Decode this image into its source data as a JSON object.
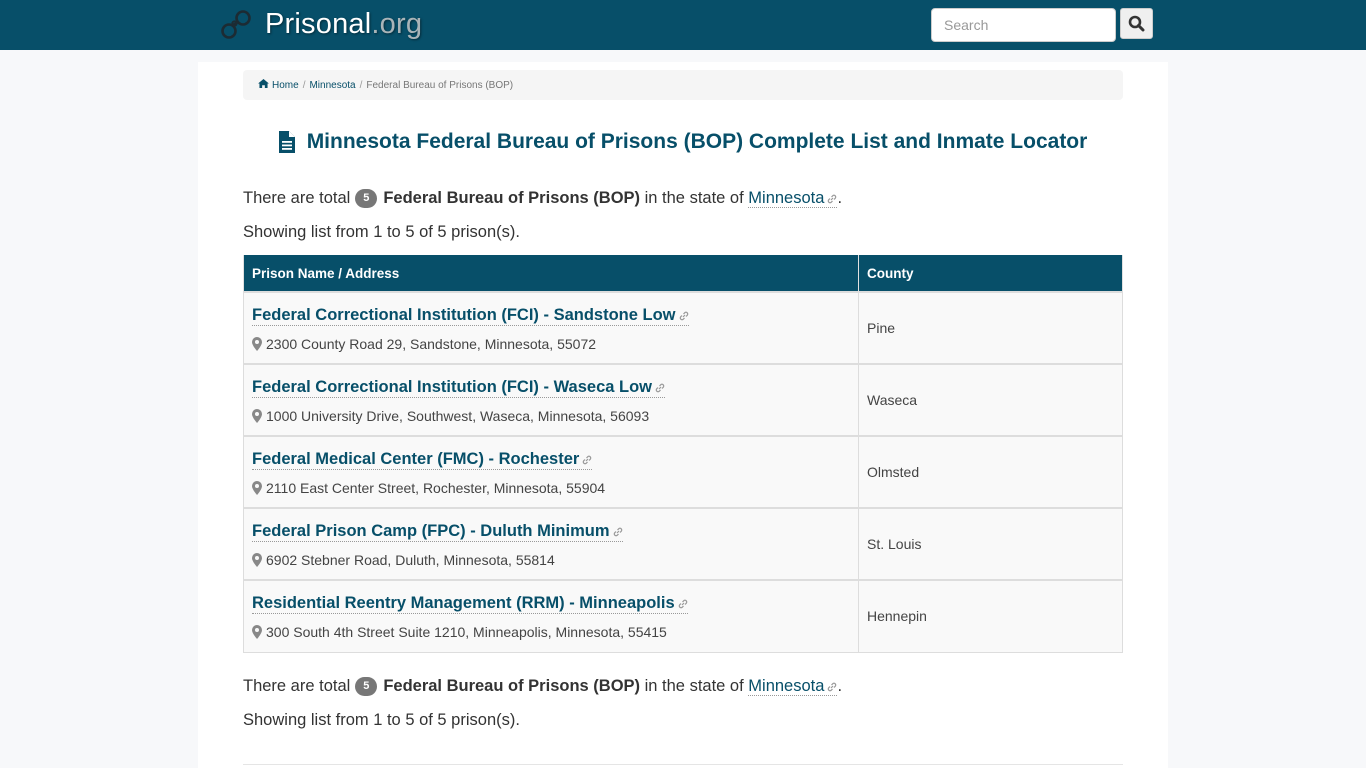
{
  "navbar": {
    "brand_name": "Prisonal",
    "brand_tld": ".org",
    "brand_icon": "handcuffs-icon",
    "search": {
      "placeholder": "Search",
      "value": "",
      "button_icon": "search-icon"
    }
  },
  "breadcrumb": {
    "items": [
      {
        "label": "Home",
        "icon": "home-icon"
      },
      {
        "label": "Minnesota"
      },
      {
        "label": "Federal Bureau of Prisons (BOP)"
      }
    ]
  },
  "page_title": {
    "icon": "document-icon",
    "text": "Minnesota Federal Bureau of Prisons (BOP) Complete List and Inmate Locator"
  },
  "summary": {
    "prefix": "There are total",
    "count": "5",
    "facility_type": "Federal Bureau of Prisons (BOP)",
    "middle": "in the state of",
    "state": "Minnesota",
    "suffix": ".",
    "showing": "Showing list from 1 to 5 of 5 prison(s)."
  },
  "table": {
    "headers": [
      "Prison Name / Address",
      "County"
    ],
    "rows": [
      {
        "name": "Federal Correctional Institution (FCI) - Sandstone Low",
        "address": "2300 County Road 29, Sandstone, Minnesota, 55072",
        "county": "Pine"
      },
      {
        "name": "Federal Correctional Institution (FCI) - Waseca Low",
        "address": "1000 University Drive, Southwest, Waseca, Minnesota, 56093",
        "county": "Waseca"
      },
      {
        "name": "Federal Medical Center (FMC) - Rochester",
        "address": "2110 East Center Street, Rochester, Minnesota, 55904",
        "county": "Olmsted"
      },
      {
        "name": "Federal Prison Camp (FPC) - Duluth Minimum",
        "address": "6902 Stebner Road, Duluth, Minnesota, 55814",
        "county": "St. Louis"
      },
      {
        "name": "Residential Reentry Management (RRM) - Minneapolis",
        "address": "300 South 4th Street Suite 1210, Minneapolis, Minnesota, 55415",
        "county": "Hennepin"
      }
    ]
  },
  "colors": {
    "brand": "#074f69",
    "badge": "#777777",
    "tld": "#a9b4b8"
  }
}
